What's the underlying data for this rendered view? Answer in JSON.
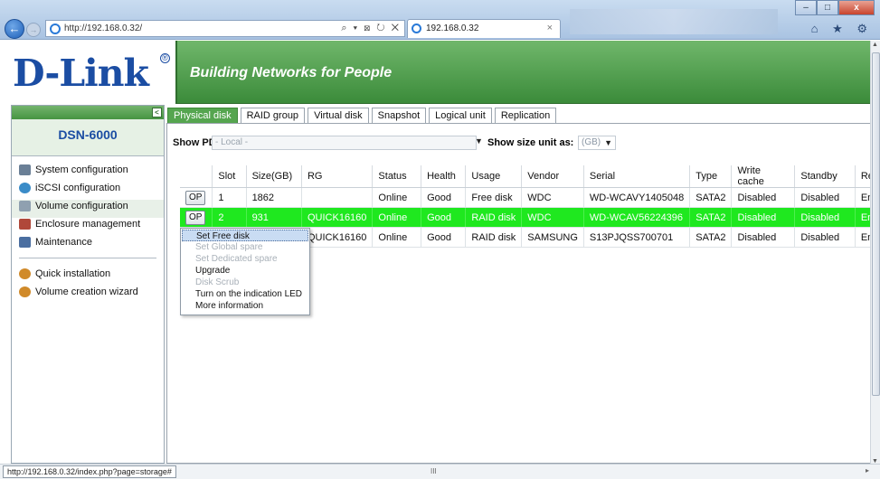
{
  "browser": {
    "address": "http://192.168.0.32/",
    "address_tools": "⌕ ▾ ⊠ ↻ ✕",
    "tab_title": "192.168.0.32",
    "tab_close": "×",
    "right_icons": "⌂ ★ ⚙",
    "min": "–",
    "max": "□",
    "close": "x",
    "back": "←",
    "forward": "→"
  },
  "header": {
    "logo": "D-Link",
    "logo_mark": "®",
    "tagline": "Building Networks for People"
  },
  "sidebar": {
    "collapse": "<",
    "model": "DSN-6000",
    "items": [
      {
        "label": "System configuration",
        "icon": "monitor-icon",
        "color": "#6a7f96"
      },
      {
        "label": "iSCSI configuration",
        "icon": "globe-icon",
        "color": "#3a8cc8"
      },
      {
        "label": "Volume configuration",
        "icon": "disk-icon",
        "color": "#8fa0b0"
      },
      {
        "label": "Enclosure management",
        "icon": "enclosure-icon",
        "color": "#b0483a"
      },
      {
        "label": "Maintenance",
        "icon": "wrench-icon",
        "color": "#4a6ea0"
      }
    ],
    "extra_items": [
      {
        "label": "Quick installation",
        "icon": "install-icon",
        "color": "#d08a2a"
      },
      {
        "label": "Volume creation wizard",
        "icon": "wizard-icon",
        "color": "#d08a2a"
      }
    ]
  },
  "tabs": [
    "Physical disk",
    "RAID group",
    "Virtual disk",
    "Snapshot",
    "Logical unit",
    "Replication"
  ],
  "filter": {
    "pd_label": "Show PD for:",
    "pd_value": "- Local -",
    "unit_label": "Show size unit as:",
    "unit_value": "(GB)",
    "dropdown_arrow": "▼"
  },
  "table": {
    "headers": [
      "",
      "Slot",
      "Size(GB)",
      "RG",
      "Status",
      "Health",
      "Usage",
      "Vendor",
      "Serial",
      "Type",
      "Write cache",
      "Standby",
      "Rea"
    ],
    "op_label": "OP",
    "rows": [
      {
        "slot": "1",
        "size": "1862",
        "rg": "",
        "status": "Online",
        "health": "Good",
        "usage": "Free disk",
        "vendor": "WDC",
        "serial": "WD-WCAVY1405048",
        "type": "SATA2",
        "write_cache": "Disabled",
        "standby": "Disabled",
        "read": "Ena"
      },
      {
        "slot": "2",
        "size": "931",
        "rg": "QUICK16160",
        "status": "Online",
        "health": "Good",
        "usage": "RAID disk",
        "vendor": "WDC",
        "serial": "WD-WCAV56224396",
        "type": "SATA2",
        "write_cache": "Disabled",
        "standby": "Disabled",
        "read": "Ena"
      },
      {
        "slot": "",
        "size": "",
        "rg": "QUICK16160",
        "status": "Online",
        "health": "Good",
        "usage": "RAID disk",
        "vendor": "SAMSUNG",
        "serial": "S13PJQSS700701",
        "type": "SATA2",
        "write_cache": "Disabled",
        "standby": "Disabled",
        "read": "Ena"
      }
    ]
  },
  "context_menu": [
    {
      "label": "Set Free disk",
      "state": "highlighted"
    },
    {
      "label": "Set Global spare",
      "state": "disabled"
    },
    {
      "label": "Set Dedicated spare",
      "state": "disabled"
    },
    {
      "label": "Upgrade",
      "state": "enabled"
    },
    {
      "label": "Disk Scrub",
      "state": "disabled"
    },
    {
      "label": "Turn on the indication LED",
      "state": "enabled"
    },
    {
      "label": "More information",
      "state": "enabled"
    }
  ],
  "status": {
    "url": "http://192.168.0.32/index.php?page=storage#",
    "hscroll": "III",
    "hscroll_right": "▸"
  }
}
